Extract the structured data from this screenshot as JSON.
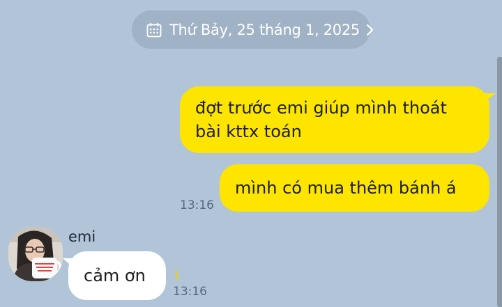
{
  "date_header": {
    "label": "Thứ Bảy, 25 tháng 1, 2025",
    "icon": "calendar-icon",
    "chevron_icon": "chevron-right-icon"
  },
  "messages": [
    {
      "direction": "outgoing",
      "text_lines": [
        "đợt trước emi giúp mình thoát",
        "bài kttx toán"
      ]
    },
    {
      "direction": "outgoing",
      "text": "mình có mua thêm bánh á",
      "time": "13:16"
    },
    {
      "direction": "incoming",
      "sender": "emi",
      "text": "cảm ơn",
      "unread_count": "1",
      "time": "13:16"
    }
  ],
  "colors": {
    "background": "#b1c4d8",
    "outgoing_bubble": "#fee500",
    "incoming_bubble": "#ffffff",
    "date_pill": "#a0b2c6",
    "unread_count": "#f0d20a"
  }
}
